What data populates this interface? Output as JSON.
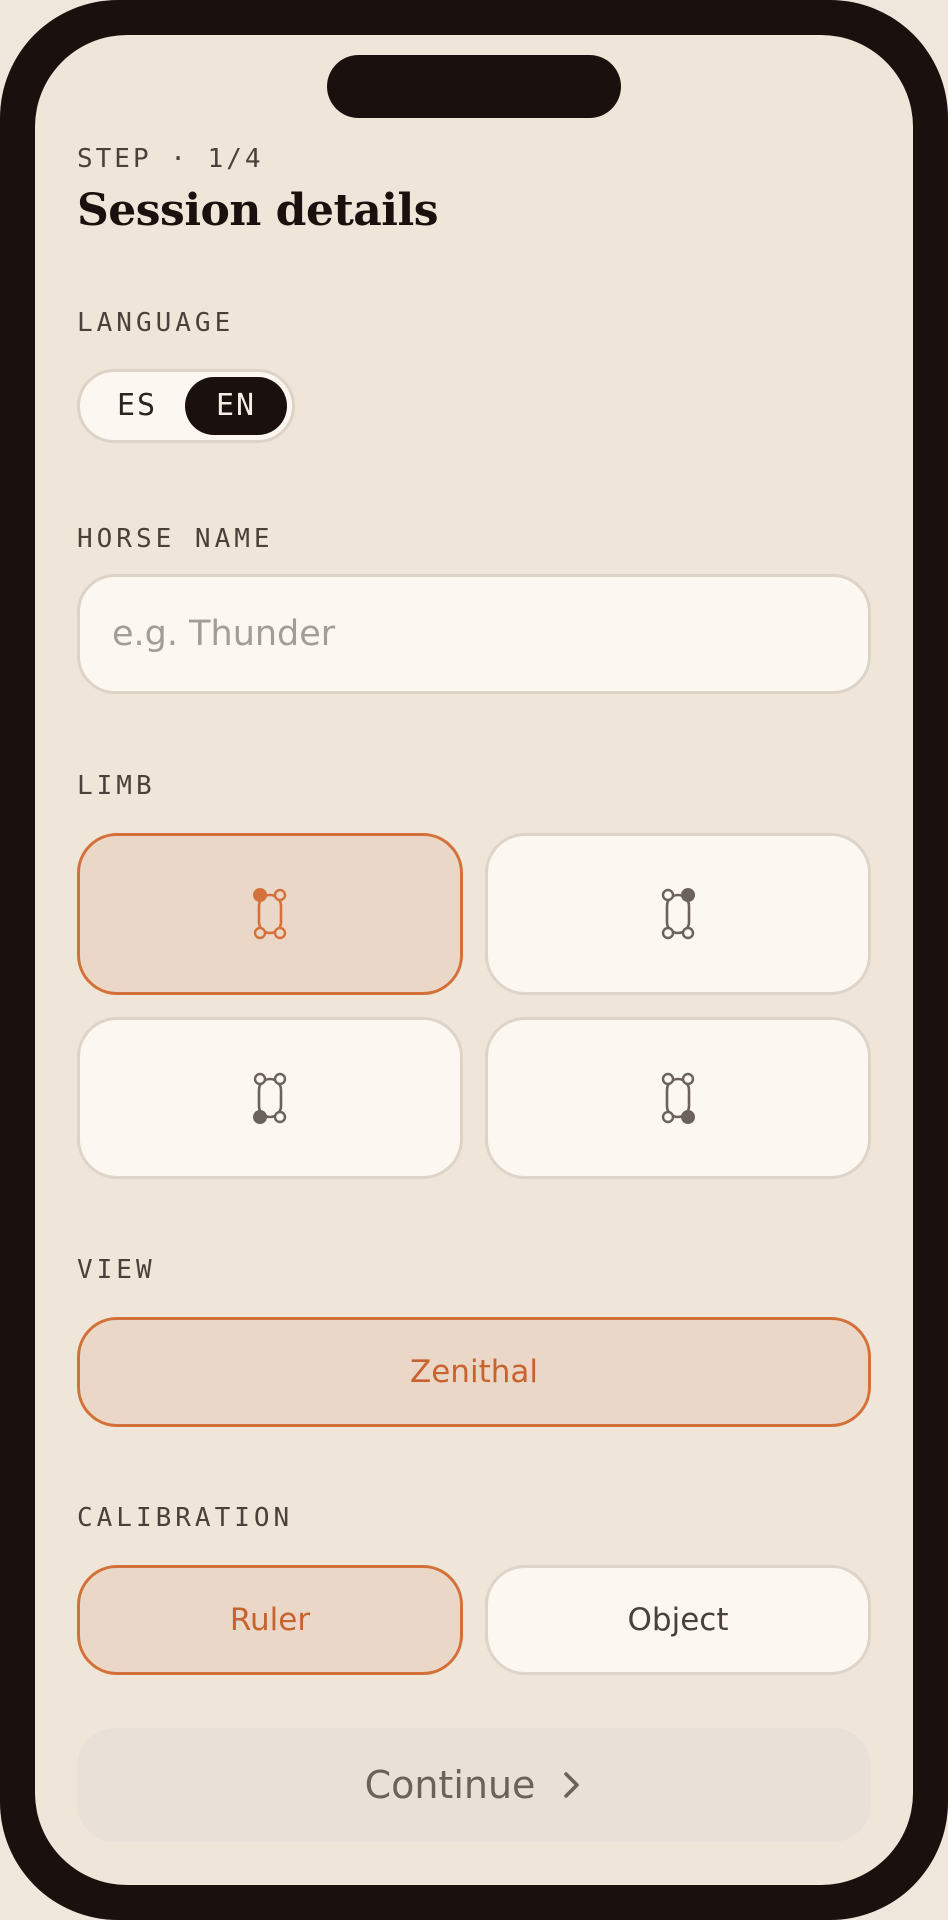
{
  "header": {
    "step": "STEP · 1/4",
    "title": "Session details"
  },
  "language": {
    "label": "LANGUAGE",
    "options": [
      "ES",
      "EN"
    ],
    "selected": "EN"
  },
  "horse_name": {
    "label": "HORSE NAME",
    "value": "",
    "placeholder": "e.g. Thunder"
  },
  "limb": {
    "label": "LIMB",
    "options": [
      {
        "icon": "front-left-limb-icon",
        "selected": true
      },
      {
        "icon": "front-right-limb-icon",
        "selected": false
      },
      {
        "icon": "hind-left-limb-icon",
        "selected": false
      },
      {
        "icon": "hind-right-limb-icon",
        "selected": false
      }
    ]
  },
  "view": {
    "label": "VIEW",
    "options": [
      "Zenithal"
    ],
    "selected": "Zenithal"
  },
  "calibration": {
    "label": "CALIBRATION",
    "options": [
      "Ruler",
      "Object"
    ],
    "selected": "Ruler"
  },
  "footer": {
    "continue_label": "Continue",
    "continue_icon": "chevron-right-icon"
  },
  "colors": {
    "accent": "#d4713a",
    "accent_bg": "#ebd7c7",
    "dark": "#1a110e",
    "surface": "#fcf8f1",
    "background": "#efe6d9"
  }
}
